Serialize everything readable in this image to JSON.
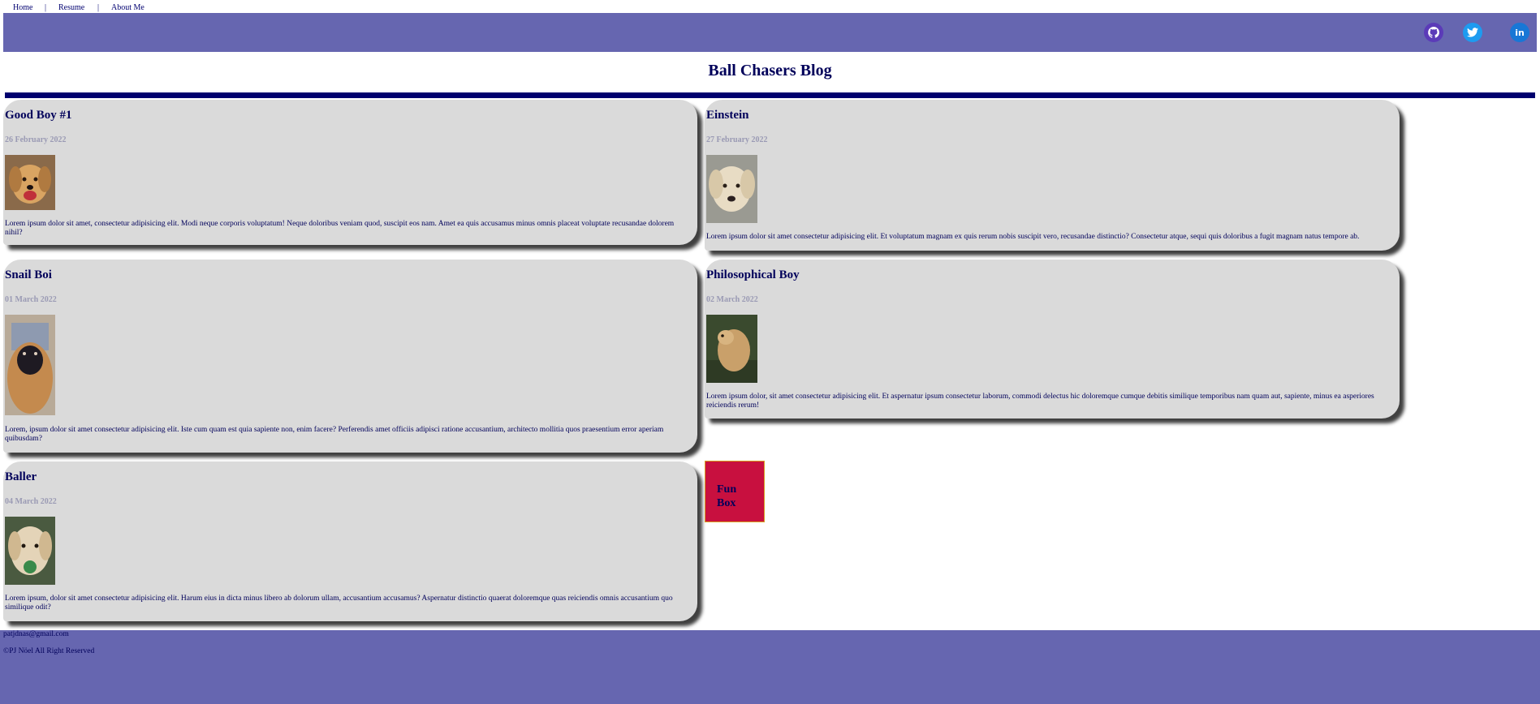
{
  "nav": {
    "links": [
      "Home",
      "Resume",
      "About Me"
    ],
    "separator": "|"
  },
  "social": {
    "github": "github-icon",
    "twitter": "twitter-icon",
    "linkedin": "linkedin-icon",
    "linkedin_text": "in"
  },
  "blog_title": "Ball Chasers Blog",
  "colors": {
    "banner": "#6666b0",
    "card": "#dadada",
    "rule": "#00006e",
    "funbox": "#c8103f",
    "text": "#000070"
  },
  "posts": [
    {
      "title": "Good Boy #1",
      "date": "26 February 2022",
      "body": "Lorem ipsum dolor sit amet, consectetur adipisicing elit. Modi neque corporis voluptatum! Neque doloribus veniam quod, suscipit eos nam. Amet ea quis accusamus minus omnis placeat voluptate recusandae dolorem nihil?"
    },
    {
      "title": "Einstein",
      "date": "27 February 2022",
      "body": "Lorem ipsum dolor sit amet consectetur adipisicing elit. Et voluptatum magnam ex quis rerum nobis suscipit vero, recusandae distinctio? Consectetur atque, sequi quis doloribus a fugit magnam natus tempore ab."
    },
    {
      "title": "Snail Boi",
      "date": "01 March 2022",
      "body": "Lorem, ipsum dolor sit amet consectetur adipisicing elit. Iste cum quam est quia sapiente non, enim facere? Perferendis amet officiis adipisci ratione accusantium, architecto mollitia quos praesentium error aperiam quibusdam?"
    },
    {
      "title": "Philosophical Boy",
      "date": "02 March 2022",
      "body": "Lorem ipsum dolor, sit amet consectetur adipisicing elit. Et aspernatur ipsum consectetur laborum, commodi delectus hic doloremque cumque debitis similique temporibus nam quam aut, sapiente, minus ea asperiores reiciendis rerum!"
    },
    {
      "title": "Baller",
      "date": "04 March 2022",
      "body": "Lorem ipsum, dolor sit amet consectetur adipisicing elit. Harum eius in dicta minus libero ab dolorum ullam, accusantium accusamus? Aspernatur distinctio quaerat doloremque quas reiciendis omnis accusantium quo similique odit?"
    }
  ],
  "fun_box": "Fun Box",
  "footer": {
    "email": "patjdnas@gmail.com",
    "copyright": "©PJ Nöel All Right Reserved"
  }
}
